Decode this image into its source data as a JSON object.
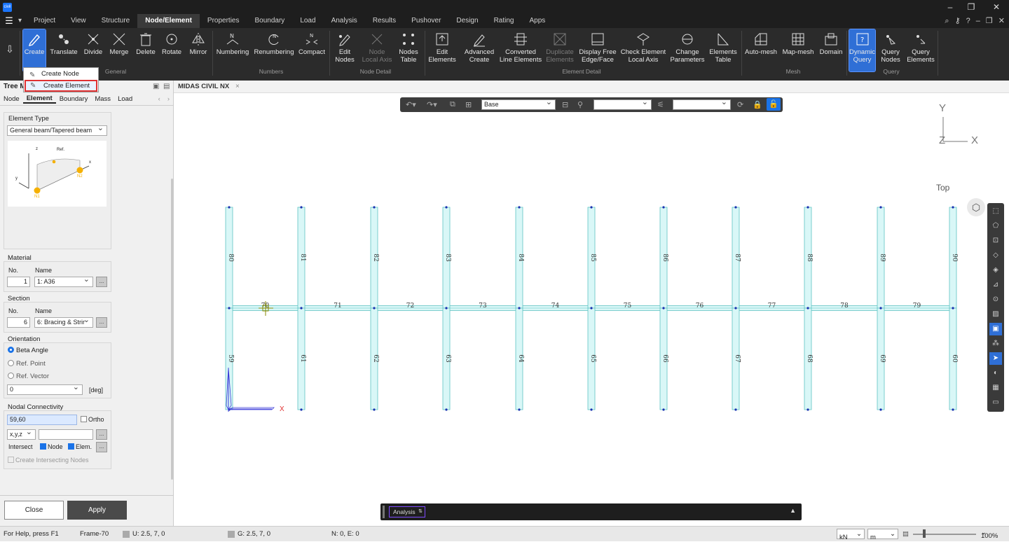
{
  "app": {
    "logo_text": "civil"
  },
  "window_controls": {
    "minimize": "–",
    "restore": "❐",
    "close": "✕"
  },
  "menu": {
    "items": [
      "Project",
      "View",
      "Structure",
      "Node/Element",
      "Properties",
      "Boundary",
      "Load",
      "Analysis",
      "Results",
      "Pushover",
      "Design",
      "Rating",
      "Apps"
    ],
    "active": "Node/Element"
  },
  "ribbon": {
    "buttons": [
      {
        "label": "Create",
        "icon": "pencil-icon"
      },
      {
        "label": "Translate",
        "icon": "translate-icon"
      },
      {
        "label": "Divide",
        "icon": "divide-icon"
      },
      {
        "label": "Merge",
        "icon": "merge-icon"
      },
      {
        "label": "Delete",
        "icon": "trash-icon"
      },
      {
        "label": "Rotate",
        "icon": "rotate-icon"
      },
      {
        "label": "Mirror",
        "icon": "mirror-icon"
      },
      {
        "label": "Numbering",
        "icon": "numbering-icon"
      },
      {
        "label": "Renumbering",
        "icon": "renumbering-icon"
      },
      {
        "label": "Compact",
        "icon": "compact-icon"
      },
      {
        "label": "Edit\nNodes",
        "icon": "edit-nodes-icon"
      },
      {
        "label": "Node\nLocal Axis",
        "icon": "node-axis-icon"
      },
      {
        "label": "Nodes\nTable",
        "icon": "nodes-table-icon"
      },
      {
        "label": "Edit\nElements",
        "icon": "edit-elements-icon"
      },
      {
        "label": "Advanced\nCreate",
        "icon": "advanced-create-icon"
      },
      {
        "label": "Converted\nLine Elements",
        "icon": "converted-line-icon"
      },
      {
        "label": "Duplicate\nElements",
        "icon": "duplicate-icon"
      },
      {
        "label": "Display Free\nEdge/Face",
        "icon": "free-edge-icon"
      },
      {
        "label": "Check Element\nLocal Axis",
        "icon": "check-axis-icon"
      },
      {
        "label": "Change\nParameters",
        "icon": "change-params-icon"
      },
      {
        "label": "Elements\nTable",
        "icon": "elements-table-icon"
      },
      {
        "label": "Auto-mesh",
        "icon": "auto-mesh-icon"
      },
      {
        "label": "Map-mesh",
        "icon": "map-mesh-icon"
      },
      {
        "label": "Domain",
        "icon": "domain-icon"
      },
      {
        "label": "Dynamic\nQuery",
        "icon": "dynamic-query-icon"
      },
      {
        "label": "Query\nNodes",
        "icon": "query-nodes-icon"
      },
      {
        "label": "Query\nElements",
        "icon": "query-elements-icon"
      }
    ],
    "groups": [
      "General",
      "Numbers",
      "Node Detail",
      "Element Detail",
      "Mesh",
      "Query"
    ]
  },
  "dropdown": {
    "items": [
      "Create Node",
      "Create Element"
    ],
    "highlighted": "Create Element"
  },
  "left_panel": {
    "title": "Tree M",
    "tabs": [
      "Node",
      "Element",
      "Boundary",
      "Mass",
      "Load"
    ],
    "active_tab": "Element",
    "element_type_label": "Element Type",
    "element_type_value": "General beam/Tapered beam",
    "diagram_labels": {
      "ref": "Ref.",
      "z": "z",
      "y": "y",
      "x": "x",
      "n1": "N1",
      "n2": "N2"
    },
    "material": {
      "heading": "Material",
      "no_label": "No.",
      "name_label": "Name",
      "no": "1",
      "name": "1: A36"
    },
    "section": {
      "heading": "Section",
      "no_label": "No.",
      "name_label": "Name",
      "no": "6",
      "name": "6: Bracing & Strir"
    },
    "orientation": {
      "heading": "Orientation",
      "options": [
        "Beta Angle",
        "Ref. Point",
        "Ref. Vector"
      ],
      "selected": "Beta Angle",
      "angle": "0",
      "unit": "[deg]"
    },
    "nodal": {
      "heading": "Nodal Connectivity",
      "value": "59,60",
      "ortho": "Ortho",
      "coord": "x,y,z",
      "intersect": "Intersect",
      "node": "Node",
      "elem": "Elem.",
      "create_intersecting": "Create Intersecting Nodes"
    },
    "close": "Close",
    "apply": "Apply"
  },
  "doc_tab": {
    "title": "MIDAS CIVIL NX",
    "close": "×"
  },
  "viewport": {
    "toolbar": {
      "base": "Base"
    },
    "axes": {
      "y": "Y",
      "z": "Z",
      "x": "X"
    },
    "view_label": "Top",
    "ucs_x": "X",
    "top_column_labels": [
      "80",
      "81",
      "82",
      "83",
      "84",
      "85",
      "86",
      "87",
      "88",
      "89",
      "90"
    ],
    "bottom_column_labels": [
      "59",
      "61",
      "62",
      "63",
      "64",
      "65",
      "66",
      "67",
      "68",
      "69",
      "60"
    ],
    "beam_labels": [
      "70",
      "71",
      "72",
      "73",
      "74",
      "75",
      "76",
      "77",
      "78",
      "79"
    ],
    "analysis_select": "Analysis"
  },
  "status": {
    "help": "For Help, press F1",
    "frame": "Frame-70",
    "u": "U: 2.5, 7, 0",
    "g": "G: 2.5, 7, 0",
    "ne": "N: 0, E: 0",
    "force_unit": "kN",
    "length_unit": "m",
    "zoom": "100%"
  },
  "colors": {
    "accent": "#2f6fd6",
    "member_fill": "#d9f7f7",
    "member_stroke": "#5fc4c4",
    "node": "#1a2fb0",
    "highlight": "#e03131"
  }
}
